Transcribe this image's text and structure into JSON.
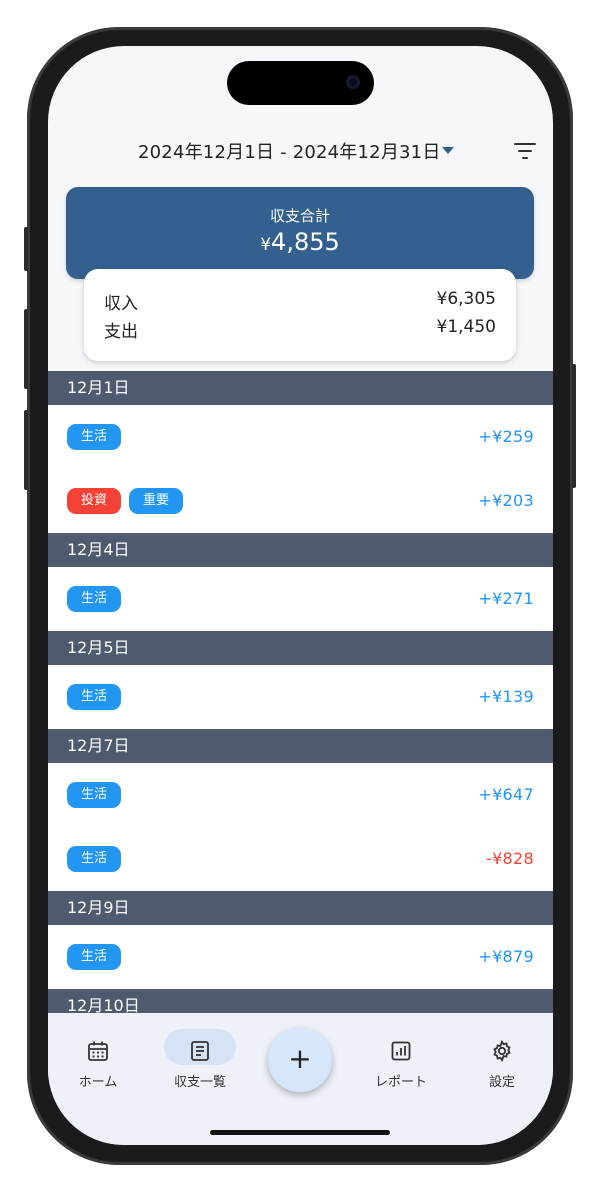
{
  "header": {
    "date_range": "2024年12月1日 - 2024年12月31日",
    "dropdown_icon": "caret-down-icon",
    "filter_icon": "filter-icon"
  },
  "summary": {
    "title": "収支合計",
    "currency": "¥",
    "total": "4,855",
    "income_label": "収入",
    "income_value": "¥6,305",
    "expense_label": "支出",
    "expense_value": "¥1,450"
  },
  "days": [
    {
      "label": "12月1日",
      "items": [
        {
          "tags": [
            {
              "text": "生活",
              "color": "#2196f3"
            }
          ],
          "amount": "+¥259",
          "type": "income"
        },
        {
          "tags": [
            {
              "text": "投資",
              "color": "#f44336"
            },
            {
              "text": "重要",
              "color": "#2196f3"
            }
          ],
          "amount": "+¥203",
          "type": "income"
        }
      ]
    },
    {
      "label": "12月4日",
      "items": [
        {
          "tags": [
            {
              "text": "生活",
              "color": "#2196f3"
            }
          ],
          "amount": "+¥271",
          "type": "income"
        }
      ]
    },
    {
      "label": "12月5日",
      "items": [
        {
          "tags": [
            {
              "text": "生活",
              "color": "#2196f3"
            }
          ],
          "amount": "+¥139",
          "type": "income"
        }
      ]
    },
    {
      "label": "12月7日",
      "items": [
        {
          "tags": [
            {
              "text": "生活",
              "color": "#2196f3"
            }
          ],
          "amount": "+¥647",
          "type": "income"
        },
        {
          "tags": [
            {
              "text": "生活",
              "color": "#2196f3"
            }
          ],
          "amount": "-¥828",
          "type": "expense"
        }
      ]
    },
    {
      "label": "12月9日",
      "items": [
        {
          "tags": [
            {
              "text": "生活",
              "color": "#2196f3"
            }
          ],
          "amount": "+¥879",
          "type": "income"
        }
      ]
    },
    {
      "label": "12月10日",
      "items": []
    }
  ],
  "nav": {
    "home": "ホーム",
    "list": "収支一覧",
    "add": "+",
    "report": "レポート",
    "settings": "設定"
  },
  "colors": {
    "primary": "#33608f",
    "income": "#2196f3",
    "expense": "#f44336",
    "date_header": "#4e5b6e"
  }
}
